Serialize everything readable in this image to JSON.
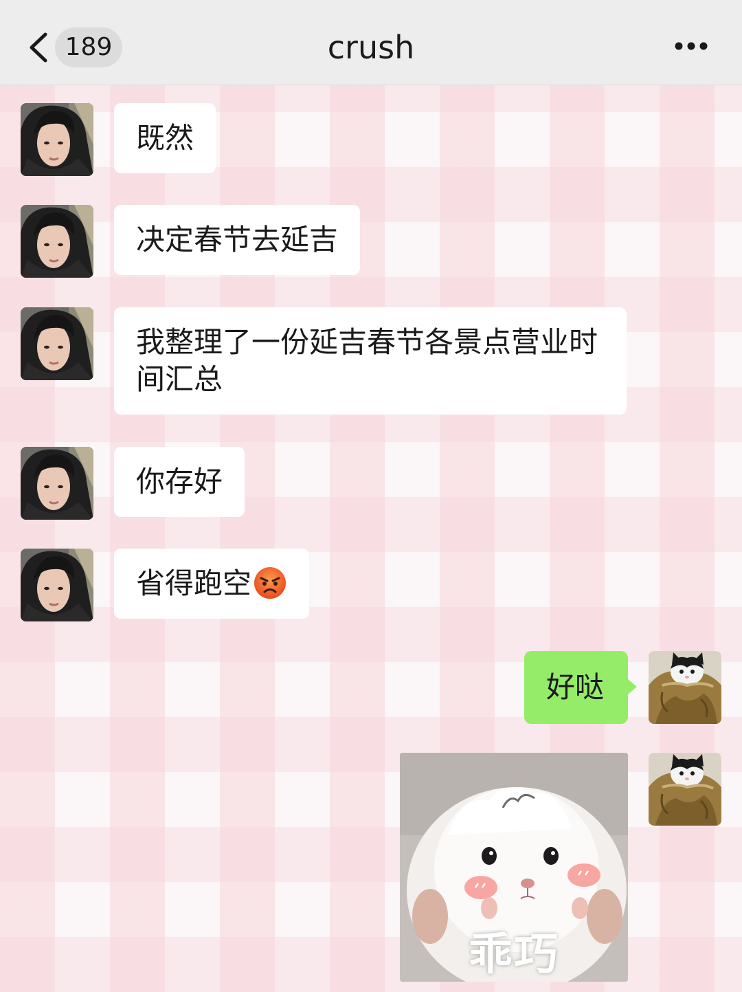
{
  "header": {
    "back_icon": "chevron-left-icon",
    "unread_count": "189",
    "title": "crush",
    "more_icon": "more-horizontal-icon"
  },
  "messages": [
    {
      "from": "crush",
      "text": "既然"
    },
    {
      "from": "crush",
      "text": "决定春节去延吉"
    },
    {
      "from": "crush",
      "text": "我整理了一份延吉春节各景点营业时间汇总"
    },
    {
      "from": "crush",
      "text": "你存好"
    },
    {
      "from": "crush",
      "text": "省得跑空",
      "emoji": "angry-face-emoji"
    },
    {
      "from": "me",
      "text": "好哒"
    },
    {
      "from": "me",
      "type": "sticker",
      "sticker_icon": "hamster-sticker",
      "caption": "乖巧"
    }
  ],
  "colors": {
    "header_bg": "#ededed",
    "incoming_bubble": "#ffffff",
    "outgoing_bubble": "#95ec69"
  }
}
